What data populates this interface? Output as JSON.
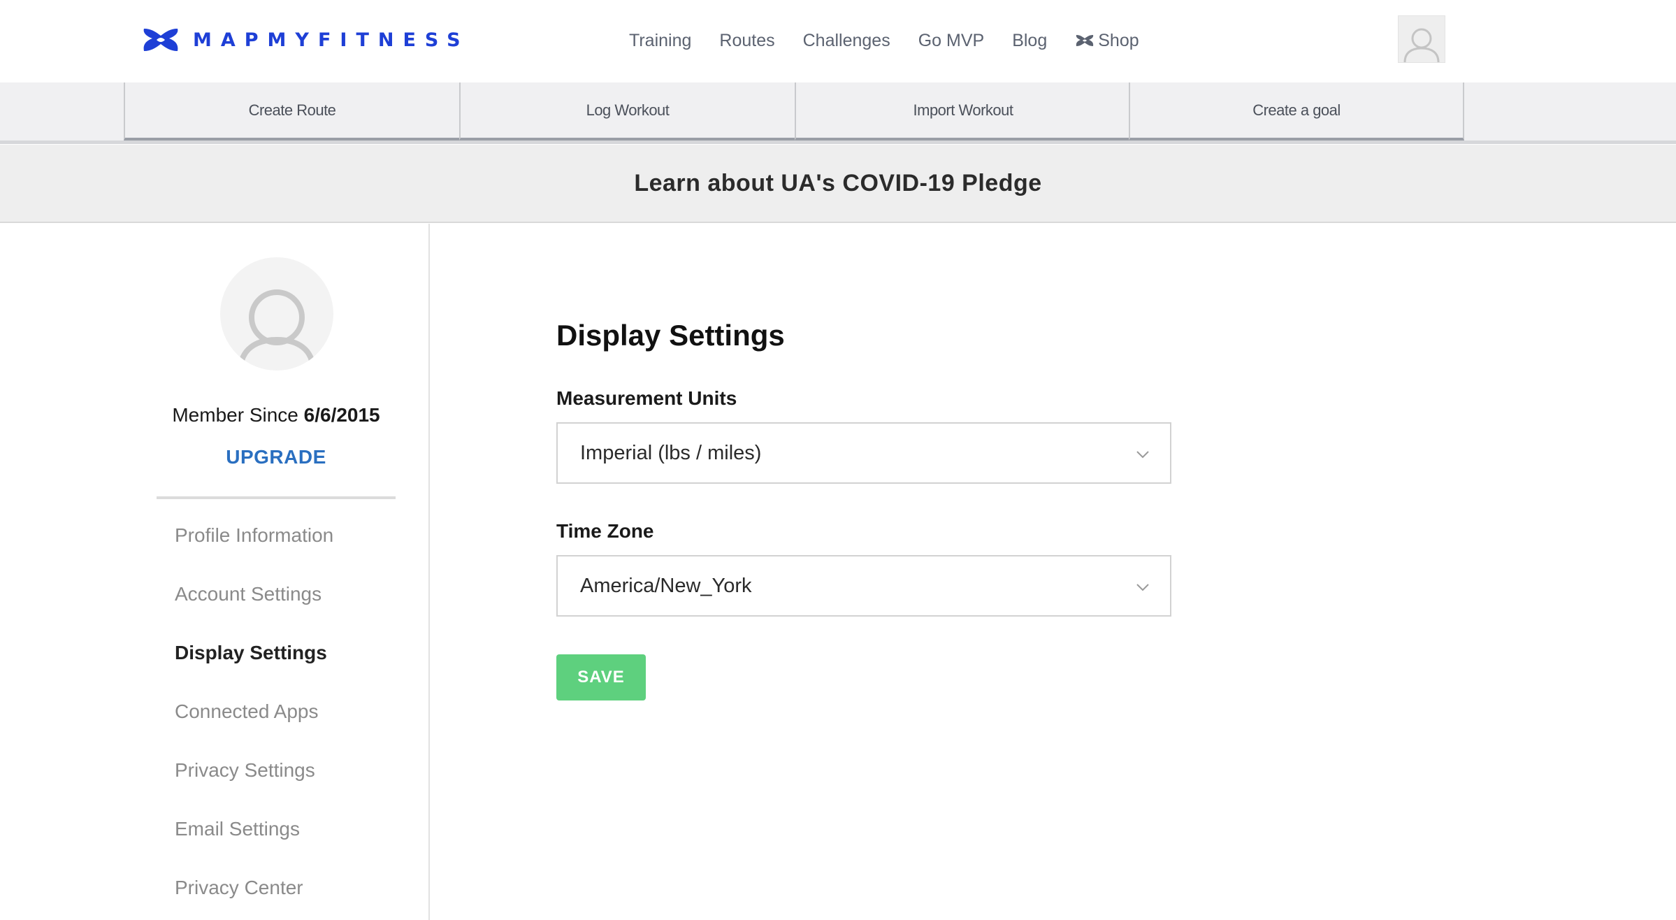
{
  "header": {
    "logo_text": "MAPMYFITNESS",
    "logo_icon": "under-armour-logo",
    "nav": [
      {
        "label": "Training"
      },
      {
        "label": "Routes"
      },
      {
        "label": "Challenges"
      },
      {
        "label": "Go MVP"
      },
      {
        "label": "Blog"
      },
      {
        "label": "Shop",
        "icon": "under-armour-logo"
      }
    ],
    "avatar_icon": "user-icon"
  },
  "action_bar": {
    "items": [
      {
        "label": "Create Route"
      },
      {
        "label": "Log Workout"
      },
      {
        "label": "Import Workout"
      },
      {
        "label": "Create a goal"
      }
    ]
  },
  "banner": {
    "text": "Learn about UA's COVID-19 Pledge"
  },
  "sidebar": {
    "avatar_icon": "user-icon",
    "member_since_label": "Member Since",
    "member_since_date": "6/6/2015",
    "upgrade_label": "UPGRADE",
    "items": [
      {
        "label": "Profile Information",
        "active": false
      },
      {
        "label": "Account Settings",
        "active": false
      },
      {
        "label": "Display Settings",
        "active": true
      },
      {
        "label": "Connected Apps",
        "active": false
      },
      {
        "label": "Privacy Settings",
        "active": false
      },
      {
        "label": "Email Settings",
        "active": false
      },
      {
        "label": "Privacy Center",
        "active": false
      }
    ]
  },
  "main": {
    "title": "Display Settings",
    "measurement_units": {
      "label": "Measurement Units",
      "value": "Imperial (lbs / miles)"
    },
    "time_zone": {
      "label": "Time Zone",
      "value": "America/New_York"
    },
    "save_label": "SAVE"
  },
  "colors": {
    "brand_blue": "#1e3fd6",
    "link_blue": "#2a6fc0",
    "save_green": "#5ed07e",
    "nav_gray": "#5b6270"
  }
}
